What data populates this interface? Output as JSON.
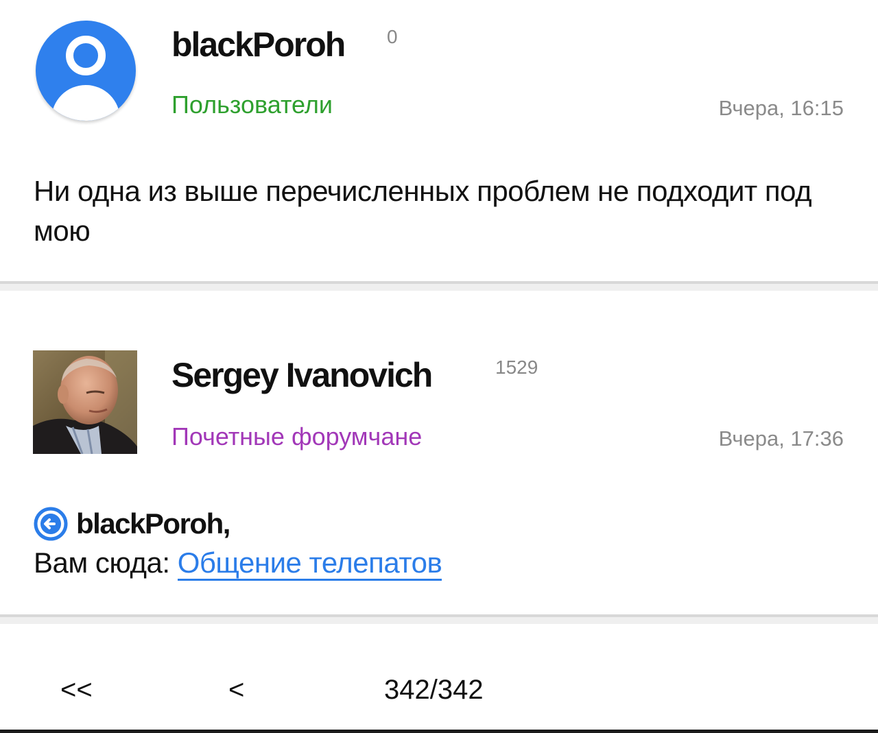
{
  "posts": [
    {
      "username": "blackPoroh",
      "reputation": "0",
      "group": "Пользователи",
      "date": "Вчера, 16:15",
      "text": "Ни одна из выше перечисленных проблем не подходит под мою",
      "avatar": "default-user-icon",
      "group_color": "#2ea02e"
    },
    {
      "username": "Sergey Ivanovich",
      "reputation": "1529",
      "group": "Почетные форумчане",
      "date": "Вчера, 17:36",
      "avatar": "user-photo",
      "group_color": "#a238b8",
      "quote_name": "blackPoroh,",
      "reply_prefix": "Вам сюда: ",
      "reply_link": "Общение телепатов",
      "link_color": "#2b7de9"
    }
  ],
  "pager": {
    "first": "<<",
    "prev": "<",
    "info": "342/342"
  }
}
